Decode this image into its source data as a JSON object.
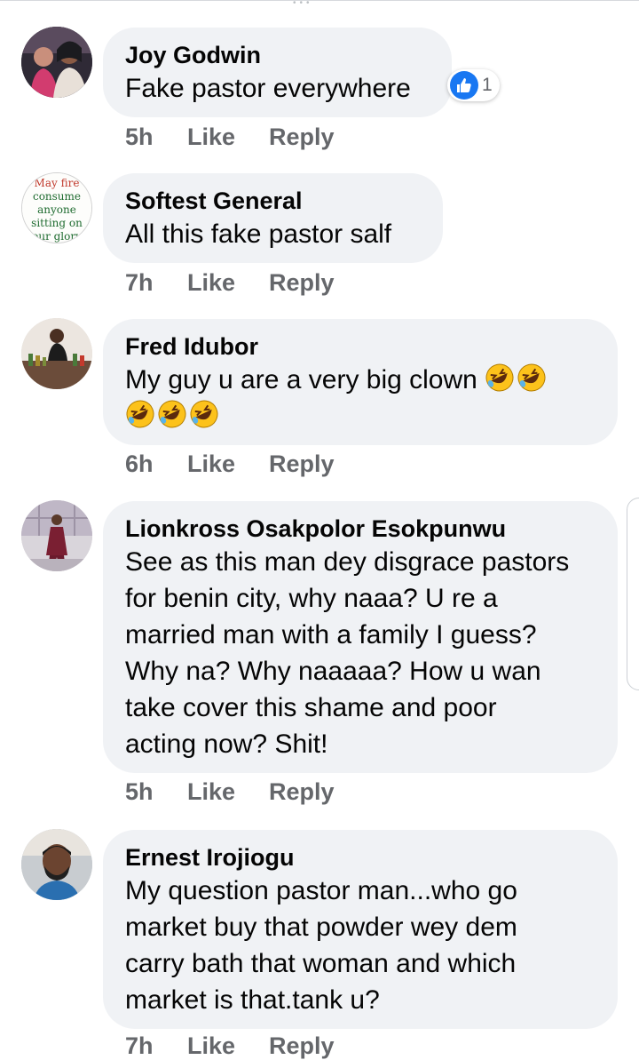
{
  "comments": [
    {
      "name": "Joy Godwin",
      "lines": [
        "Fake pastor everywhere"
      ],
      "time": "5h",
      "like": "Like",
      "reply": "Reply",
      "reactions": {
        "icon": "thumbs-up-icon",
        "count": "1"
      }
    },
    {
      "name": "Softest General",
      "lines": [
        "All this fake pastor salf"
      ],
      "time": "7h",
      "like": "Like",
      "reply": "Reply",
      "avatar_text": [
        "May fire",
        "consume",
        "anyone",
        "sitting on",
        "our glory"
      ]
    },
    {
      "name": "Fred Idubor",
      "lines": [
        "My guy u are a very big clown"
      ],
      "emoji_icon": "rolling-on-floor-laughing-icon",
      "time": "6h",
      "like": "Like",
      "reply": "Reply"
    },
    {
      "name": "Lionkross Osakpolor Esokpunwu",
      "lines": [
        "See as this man dey disgrace pastors",
        "for benin city, why naaa? U re a",
        "married man with a family I guess?",
        "Why na? Why naaaaa? How u wan",
        "take cover this shame and poor",
        "acting now? Shit!"
      ],
      "time": "5h",
      "like": "Like",
      "reply": "Reply"
    },
    {
      "name": "Ernest Irojiogu",
      "lines": [
        "My question pastor man...who go",
        "market buy that powder wey dem",
        "carry bath that woman and which",
        "market is that.tank u?"
      ],
      "time": "7h",
      "like": "Like",
      "reply": "Reply"
    }
  ],
  "colors": {
    "bubble": "#f0f2f5",
    "meta": "#65676b",
    "like_blue": "#1877f2"
  }
}
